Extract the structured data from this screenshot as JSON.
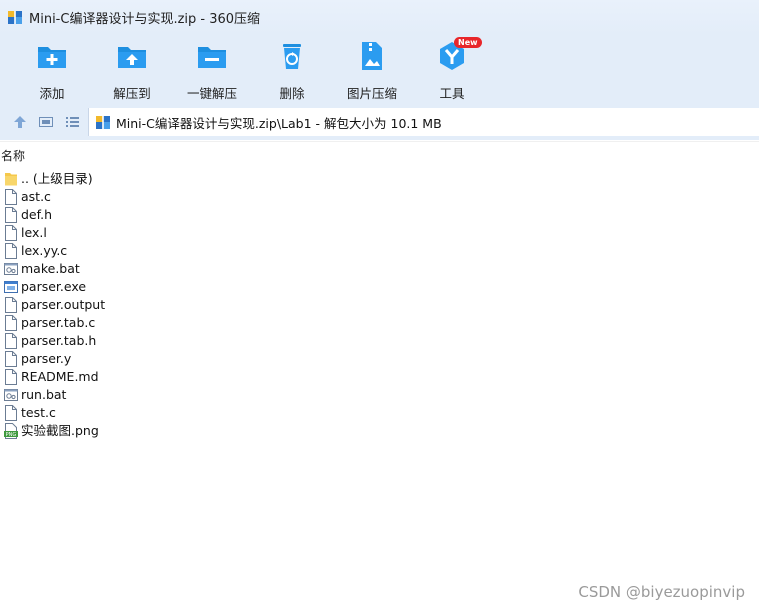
{
  "window": {
    "title": "Mini-C编译器设计与实现.zip - 360压缩",
    "app_icon": "archive-app-icon"
  },
  "toolbar": {
    "items": [
      {
        "label": "添加",
        "icon": "add-folder-icon"
      },
      {
        "label": "解压到",
        "icon": "extract-to-icon"
      },
      {
        "label": "一键解压",
        "icon": "one-click-extract-icon"
      },
      {
        "label": "删除",
        "icon": "recycle-delete-icon"
      },
      {
        "label": "图片压缩",
        "icon": "image-compress-icon"
      },
      {
        "label": "工具",
        "icon": "tools-icon",
        "badge": "New"
      }
    ]
  },
  "address": {
    "path": "Mini-C编译器设计与实现.zip\\Lab1 - 解包大小为 10.1 MB"
  },
  "list": {
    "column_name": "名称",
    "files": [
      {
        "name": ".. (上级目录)",
        "icon": "folder-up-icon"
      },
      {
        "name": "ast.c",
        "icon": "file-icon"
      },
      {
        "name": "def.h",
        "icon": "file-icon"
      },
      {
        "name": "lex.l",
        "icon": "file-icon"
      },
      {
        "name": "lex.yy.c",
        "icon": "file-icon"
      },
      {
        "name": "make.bat",
        "icon": "batch-file-icon"
      },
      {
        "name": "parser.exe",
        "icon": "exe-file-icon"
      },
      {
        "name": "parser.output",
        "icon": "file-icon"
      },
      {
        "name": "parser.tab.c",
        "icon": "file-icon"
      },
      {
        "name": "parser.tab.h",
        "icon": "file-icon"
      },
      {
        "name": "parser.y",
        "icon": "file-icon"
      },
      {
        "name": "README.md",
        "icon": "file-icon"
      },
      {
        "name": "run.bat",
        "icon": "batch-file-icon"
      },
      {
        "name": "test.c",
        "icon": "file-icon"
      },
      {
        "name": "实验截图.png",
        "icon": "png-file-icon"
      }
    ]
  },
  "watermark": "CSDN @biyezuopinvip",
  "colors": {
    "toolbar_bg": "#e3edf9",
    "icon_blue": "#1e8fe0",
    "badge_red": "#e8262a"
  }
}
